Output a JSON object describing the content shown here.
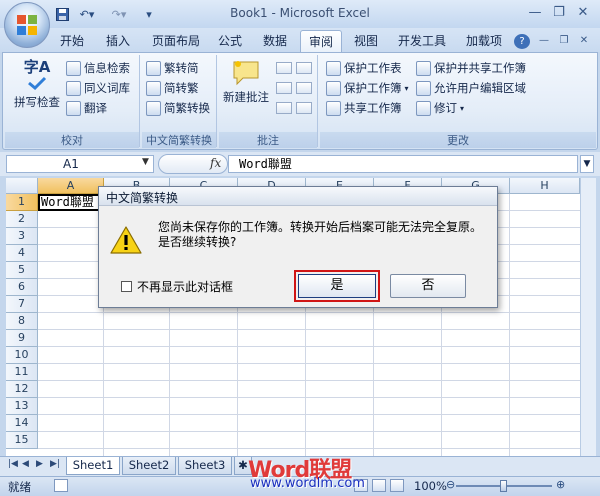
{
  "window": {
    "title": "Book1 - Microsoft Excel",
    "minimize": "—",
    "restore": "❐",
    "close": "✕"
  },
  "qat": {
    "save_icon": "save-icon",
    "undo": "↶▾",
    "redo": "↷▾",
    "customize": "▾"
  },
  "tabs": [
    "开始",
    "插入",
    "页面布局",
    "公式",
    "数据",
    "审阅",
    "视图",
    "开发工具",
    "加载项"
  ],
  "active_tab": "审阅",
  "ribbon_help": "?",
  "ribbon_ctrl": {
    "min": "—",
    "restore": "❐",
    "close": "✕"
  },
  "ribbon": {
    "proofing": {
      "label": "校对",
      "spellcheck": "拼写检查",
      "research": "信息检索",
      "thesaurus": "同义词库",
      "translate": "翻译",
      "abc": "字A"
    },
    "chinese": {
      "label": "中文简繁转换",
      "to_simplified": "繁转简",
      "to_traditional": "简转繁",
      "convert": "简繁转换"
    },
    "comments": {
      "label": "批注",
      "new_comment": "新建批注"
    },
    "changes": {
      "label": "更改",
      "protect_sheet": "保护工作表",
      "protect_workbook": "保护工作簿",
      "share_workbook": "共享工作簿",
      "protect_share": "保护并共享工作簿",
      "allow_edit": "允许用户编辑区域",
      "track": "修订"
    }
  },
  "formula_bar": {
    "name_box": "A1",
    "fx": "fx",
    "content": "Word聯盟"
  },
  "grid": {
    "columns": [
      "A",
      "B",
      "C",
      "D",
      "E",
      "F",
      "G",
      "H"
    ],
    "rows": [
      "1",
      "2",
      "3",
      "4",
      "5",
      "6",
      "7",
      "8",
      "9",
      "10",
      "11",
      "12",
      "13",
      "14",
      "15"
    ],
    "cell_a1": "Word聯盟"
  },
  "sheets": [
    "Sheet1",
    "Sheet2",
    "Sheet3"
  ],
  "status": {
    "ready": "就绪",
    "zoom": "100%",
    "zoom_level_pct": 100
  },
  "dialog": {
    "title": "中文简繁转换",
    "message": "您尚未保存你的工作簿。转换开始后档案可能无法完全复原。是否继续转换?",
    "checkbox_label": "不再显示此对话框",
    "yes": "是",
    "no": "否"
  },
  "watermark": {
    "brand": "Word联盟",
    "url": "www.wordlm.com"
  }
}
